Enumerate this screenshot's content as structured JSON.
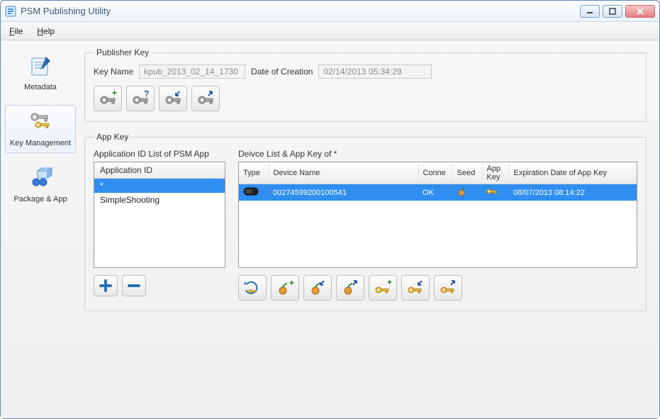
{
  "window": {
    "title": "PSM Publishing Utility"
  },
  "menu": {
    "file": "File",
    "help": "Help"
  },
  "sidebar": {
    "items": [
      {
        "label": "Metadata"
      },
      {
        "label": "Key Management"
      },
      {
        "label": "Package & App"
      }
    ]
  },
  "publisherKey": {
    "legend": "Publisher Key",
    "keyNameLabel": "Key Name",
    "keyNameValue": "kpub_2013_02_14_1730",
    "dateLabel": "Date of Creation",
    "dateValue": "02/14/2013 05:34:29"
  },
  "appKey": {
    "legend": "App Key",
    "leftLabel": "Application ID List of PSM App",
    "rightLabel": "Deivce List & App Key of *",
    "appIdHeader": "Application ID",
    "appIds": [
      "*",
      "SimpleShooting"
    ],
    "gridHeaders": {
      "type": "Type",
      "deviceName": "Device Name",
      "conn": "Conne",
      "seed": "Seed",
      "appKey": "App Key",
      "expiry": "Expiration Date of App Key"
    },
    "gridRow": {
      "deviceName": "00274599200100541",
      "conn": "OK",
      "expiry": "08/07/2013 08:14:22"
    }
  }
}
